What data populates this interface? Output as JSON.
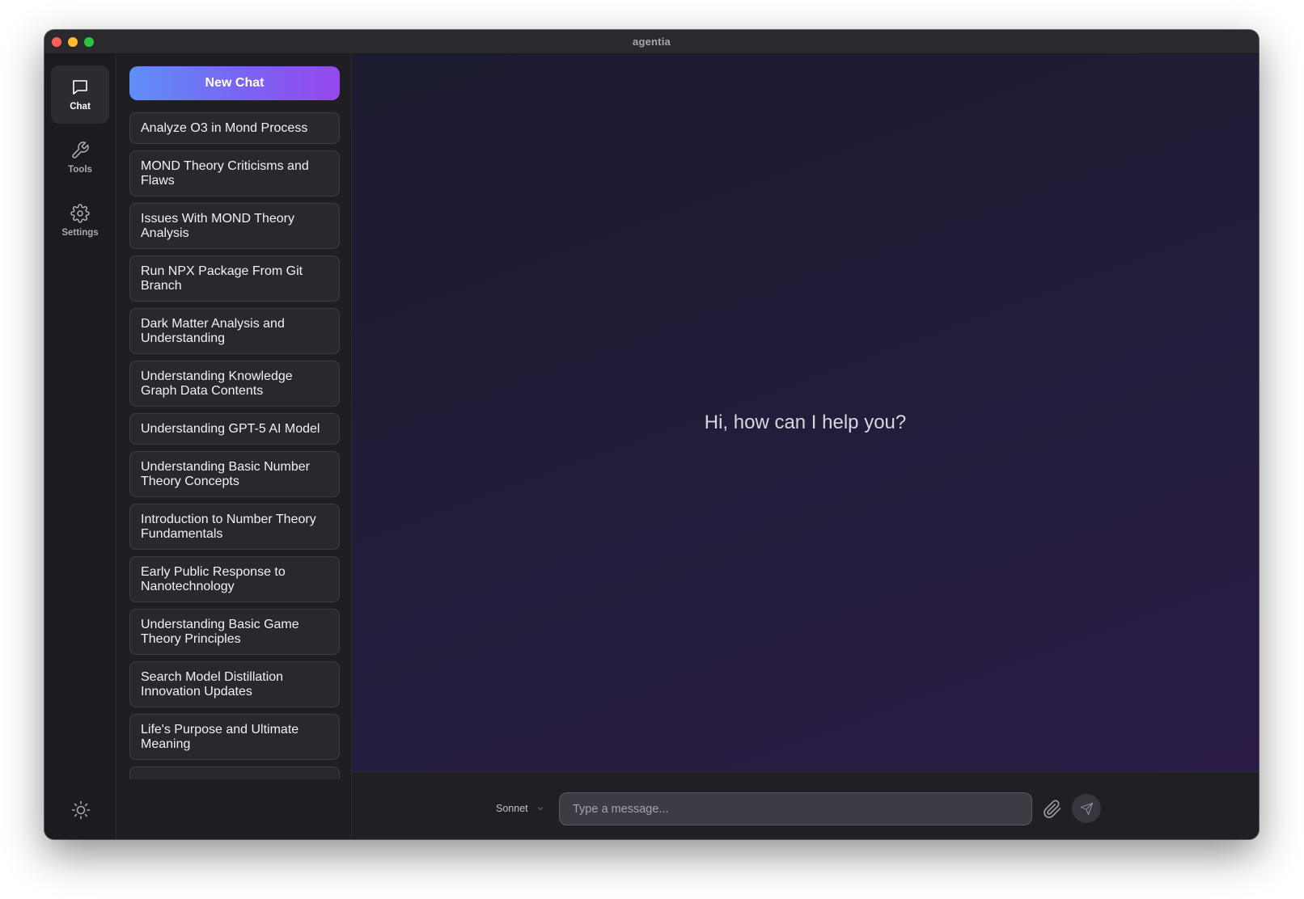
{
  "window": {
    "title": "agentia"
  },
  "rail": {
    "items": [
      {
        "label": "Chat",
        "icon": "chat-bubble-icon",
        "active": true
      },
      {
        "label": "Tools",
        "icon": "wrench-icon",
        "active": false
      },
      {
        "label": "Settings",
        "icon": "gear-icon",
        "active": false
      }
    ],
    "theme_toggle_icon": "sun-icon"
  },
  "sidebar": {
    "new_chat_label": "New Chat",
    "new_chat_gradient": [
      "#5f8ff8",
      "#9648ec"
    ],
    "chats": [
      "Analyze O3 in Mond Process",
      "MOND Theory Criticisms and Flaws",
      "Issues With MOND Theory Analysis",
      "Run NPX Package From Git Branch",
      "Dark Matter Analysis and Understanding",
      "Understanding Knowledge Graph Data Contents",
      "Understanding GPT-5 AI Model",
      "Understanding Basic Number Theory Concepts",
      "Introduction to Number Theory Fundamentals",
      "Early Public Response to Nanotechnology",
      "Understanding Basic Game Theory Principles",
      "Search Model Distillation Innovation Updates",
      "Life's Purpose and Ultimate Meaning"
    ]
  },
  "main": {
    "greeting": "Hi, how can I help you?"
  },
  "composer": {
    "model": "Sonnet",
    "placeholder": "Type a message...",
    "attach_icon": "paperclip-icon",
    "send_icon": "send-icon"
  }
}
